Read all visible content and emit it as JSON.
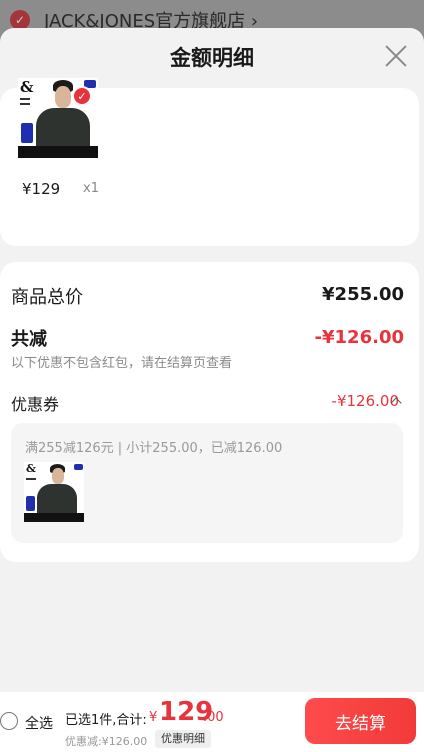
{
  "store": {
    "name": "JACK&JONES官方旗舰店 ›"
  },
  "sheet": {
    "title": "金额明细"
  },
  "item": {
    "brand_mark": "&",
    "price": "¥129",
    "qty": "x1"
  },
  "summary": {
    "total_label": "商品总价",
    "total_value": "¥255.00",
    "discount_label": "共减",
    "discount_value": "-¥126.00",
    "discount_note": "以下优惠不包含红包，请在结算页查看",
    "coupon_label": "优惠券",
    "coupon_value": "-¥126.00",
    "coupon_desc": "满255减126元 | 小计255.00，已减126.00"
  },
  "bottom": {
    "select_all": "全选",
    "selected": "已选1件,合计:",
    "currency": "¥",
    "total_int": "129",
    "total_dec": ".00",
    "discount": "优惠减:¥126.00",
    "detail_chip": "优惠明细",
    "checkout": "去结算"
  },
  "colors": {
    "accent": "#e8323c",
    "button": "#f23a3a"
  }
}
